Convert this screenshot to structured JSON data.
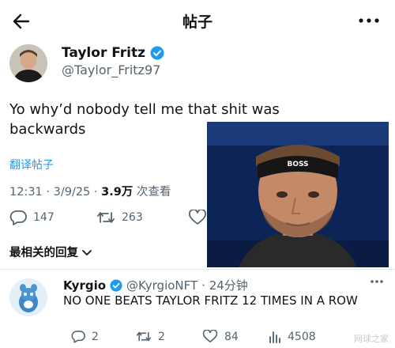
{
  "header": {
    "title": "帖子",
    "back_icon": "arrow-left-icon",
    "more_icon": "more-dots-icon"
  },
  "tweet": {
    "author_name": "Taylor Fritz",
    "author_handle": "@Taylor_Fritz97",
    "text": "Yo why’d nobody tell me that shit was backwards",
    "translate_label": "翻译帖子",
    "timestamp": "12:31 · 3/9/25 · ",
    "views": "3.9万",
    "views_suffix": " 次查看",
    "replies": "147",
    "retweets": "263"
  },
  "replies_section": {
    "sort_label": "最相关的回复"
  },
  "reply": {
    "author_name": "Kyrgio",
    "author_handle": "@KyrgioNFT",
    "time": "· 24分钟",
    "text": "NO ONE BEATS TAYLOR FRITZ 12 TIMES IN A ROW",
    "replies": "2",
    "retweets": "2",
    "likes": "84",
    "views": "4508"
  },
  "photo": {
    "headband_text": "BOSS"
  },
  "watermark": "网球之家",
  "colors": {
    "accent": "#1d9bf0",
    "muted": "#536471",
    "text": "#0f1419"
  }
}
